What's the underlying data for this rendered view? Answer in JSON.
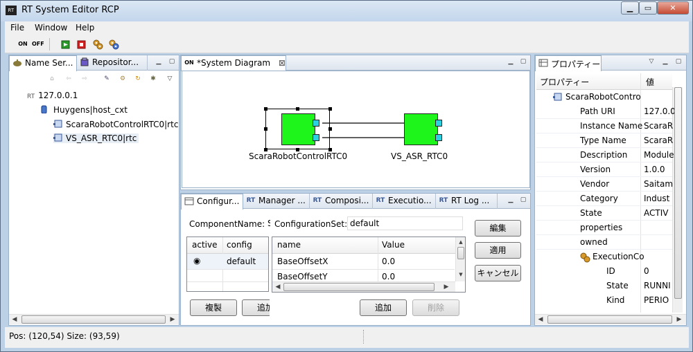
{
  "window": {
    "title": "RT System Editor RCP",
    "app_icon_text": "RT",
    "minimize_label": "▁",
    "restore_label": "▭",
    "close_label": "✕"
  },
  "menubar": {
    "items": [
      "File",
      "Window",
      "Help"
    ]
  },
  "toolbar": {
    "icons": [
      "all-on-icon",
      "all-off-icon",
      "activate-icon",
      "deactivate-icon",
      "config-gear-icon",
      "config-gear-alt-icon"
    ],
    "on_label": "ON",
    "off_label": "OFF"
  },
  "name_service_panel": {
    "tabs": [
      "Name Ser...",
      "Repositor..."
    ],
    "tree": {
      "root": "127.0.0.1",
      "host": "Huygens|host_cxt",
      "items": [
        "ScaraRobotControlRTC0|rtc",
        "VS_ASR_RTC0|rtc"
      ]
    }
  },
  "diagram_panel": {
    "tab_label": "*System Diagram",
    "tab_icon_text": "ON",
    "components": [
      {
        "label": "ScaraRobotControlRTC0"
      },
      {
        "label": "VS_ASR_RTC0"
      }
    ]
  },
  "config_panel": {
    "tabs": [
      "Configur...",
      "Manager ...",
      "Composi...",
      "Executio...",
      "RT Log ..."
    ],
    "component_name_label": "ComponentName:",
    "component_name_value": "S",
    "configuration_set_label": "ConfigurationSet:",
    "configuration_set_value": "default",
    "sets_table": {
      "headers": [
        "active",
        "config"
      ],
      "rows": [
        {
          "active": "◉",
          "config": "default"
        }
      ]
    },
    "params_table": {
      "headers": [
        "name",
        "Value"
      ],
      "rows": [
        {
          "name": "BaseOffsetX",
          "value": "0.0"
        },
        {
          "name": "BaseOffsetY",
          "value": "0.0"
        }
      ]
    },
    "buttons": {
      "edit": "編集",
      "apply": "適用",
      "cancel": "キャンセル",
      "copy": "複製",
      "add_set": "追加",
      "add_param": "追加",
      "delete_param": "削除"
    }
  },
  "properties_panel": {
    "tab_label": "プロパティー",
    "headers": [
      "プロパティー",
      "値"
    ],
    "root": "ScaraRobotContro",
    "rows": [
      {
        "name": "Path URI",
        "value": "127.0.0"
      },
      {
        "name": "Instance Name",
        "value": "ScaraR"
      },
      {
        "name": "Type Name",
        "value": "ScaraR"
      },
      {
        "name": "Description",
        "value": "Module"
      },
      {
        "name": "Version",
        "value": "1.0.0"
      },
      {
        "name": "Vendor",
        "value": "Saitam"
      },
      {
        "name": "Category",
        "value": "Indust"
      },
      {
        "name": "State",
        "value": "ACTIV"
      },
      {
        "name": "properties",
        "value": ""
      },
      {
        "name": "owned",
        "value": ""
      }
    ],
    "execution_context": {
      "name": "ExecutionCo",
      "rows": [
        {
          "name": "ID",
          "value": "0"
        },
        {
          "name": "State",
          "value": "RUNNI"
        },
        {
          "name": "Kind",
          "value": "PERIO"
        }
      ]
    }
  },
  "statusbar": {
    "text": "Pos: (120,54) Size: (93,59)"
  },
  "colors": {
    "component_fill": "#1ef51a",
    "port_fill": "#2ad2e0",
    "window_frame": "#bcd0e6"
  }
}
